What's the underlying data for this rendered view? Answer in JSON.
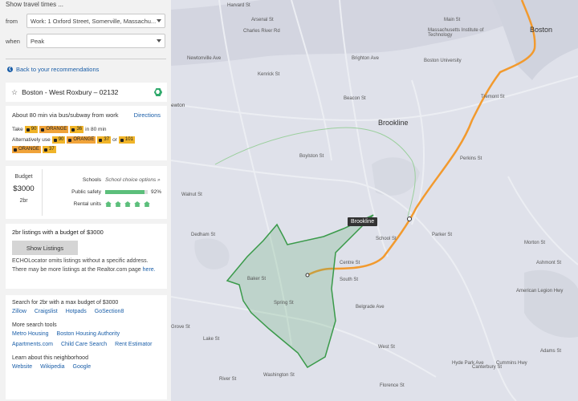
{
  "travel": {
    "title": "Show travel times ...",
    "from_label": "from",
    "from_value": "Work: 1 Oxford Street, Somerville, Massachu...",
    "when_label": "when",
    "when_value": "Peak"
  },
  "back_link": "Back to your recommendations",
  "neighborhood": {
    "name": "Boston - West Roxbury – 02132"
  },
  "commute": {
    "summary": "About 80 min via bus/subway from work",
    "directions": "Directions",
    "take_label": "Take",
    "in_text": "in 80 min",
    "alt_label": "Alternatively use",
    "or_text": "or",
    "routes_primary": [
      "90",
      "ORANGE",
      "36"
    ],
    "routes_alt1": [
      "90",
      "ORANGE",
      "37"
    ],
    "routes_alt2": [
      "101",
      "ORANGE",
      "37"
    ]
  },
  "stats": {
    "budget_label": "Budget",
    "budget_value": "$3000",
    "bedrooms": "2br",
    "schools_label": "Schools",
    "schools_value": "School choice options »",
    "safety_label": "Public safety",
    "safety_value": "92%",
    "safety_fraction": 0.92,
    "rental_label": "Rental units",
    "rental_units_level": 5
  },
  "listings": {
    "heading": "2br listings with a budget of $3000",
    "button": "Show Listings",
    "note": "ECHOLocator omits listings without a specific address. There may be more listings at the Realtor.com page",
    "note_link": "here."
  },
  "search": {
    "heading": "Search for 2br with a max budget of $3000",
    "links": [
      "Zillow",
      "Craigslist",
      "Hotpads",
      "GoSection8"
    ],
    "more_heading": "More search tools",
    "more_links_1": [
      "Metro Housing",
      "Boston Housing Authority"
    ],
    "more_links_2": [
      "Apartments.com",
      "Child Care Search",
      "Rent Estimator"
    ],
    "learn_heading": "Learn about this neighborhood",
    "learn_links": [
      "Website",
      "Wikipedia",
      "Google"
    ]
  },
  "map": {
    "pin_label": "Brookline",
    "labels": {
      "boston": "Boston",
      "brookline": "Brookline",
      "newton": "ewton",
      "mit": "Massachusetts Institute of Technology",
      "bu": "Boston University",
      "main_st": "Main St",
      "harvard_st": "Harvard St",
      "arsenal_st": "Arsenal St",
      "charles_river": "Charles River Rd",
      "brighton_ave": "Brighton Ave",
      "beacon_st": "Beacon St",
      "newtonville": "Newtonville Ave",
      "kenrick": "Kenrick St",
      "boylston": "Boylston St",
      "centre_st": "Centre St",
      "south_st": "South St",
      "washington_st": "Washington St",
      "spring_st": "Spring St",
      "west_st": "West St",
      "tremont": "Tremont St",
      "lake_st": "Lake St",
      "walnut": "Walnut St",
      "dedham": "Dedham St",
      "grove": "Grove St",
      "adams": "Adams St",
      "river_st": "River St",
      "baker": "Baker St",
      "belgrade": "Belgrade Ave",
      "perkins": "Perkins St",
      "hyde_park": "Hyde Park Ave",
      "canterbury": "Canterbury St",
      "american_legion": "American Legion Hwy",
      "morton": "Morton St",
      "ashmont": "Ashmont St",
      "cummins": "Cummins Hwy",
      "florence": "Florence St",
      "parker": "Parker St",
      "school": "School St"
    }
  },
  "colors": {
    "accent_link": "#1a5ea8",
    "route_chip": "#f0b429",
    "orange_line": "#f29a2e",
    "boundary": "#3a9a4a",
    "score_green": "#5cbf7b"
  }
}
